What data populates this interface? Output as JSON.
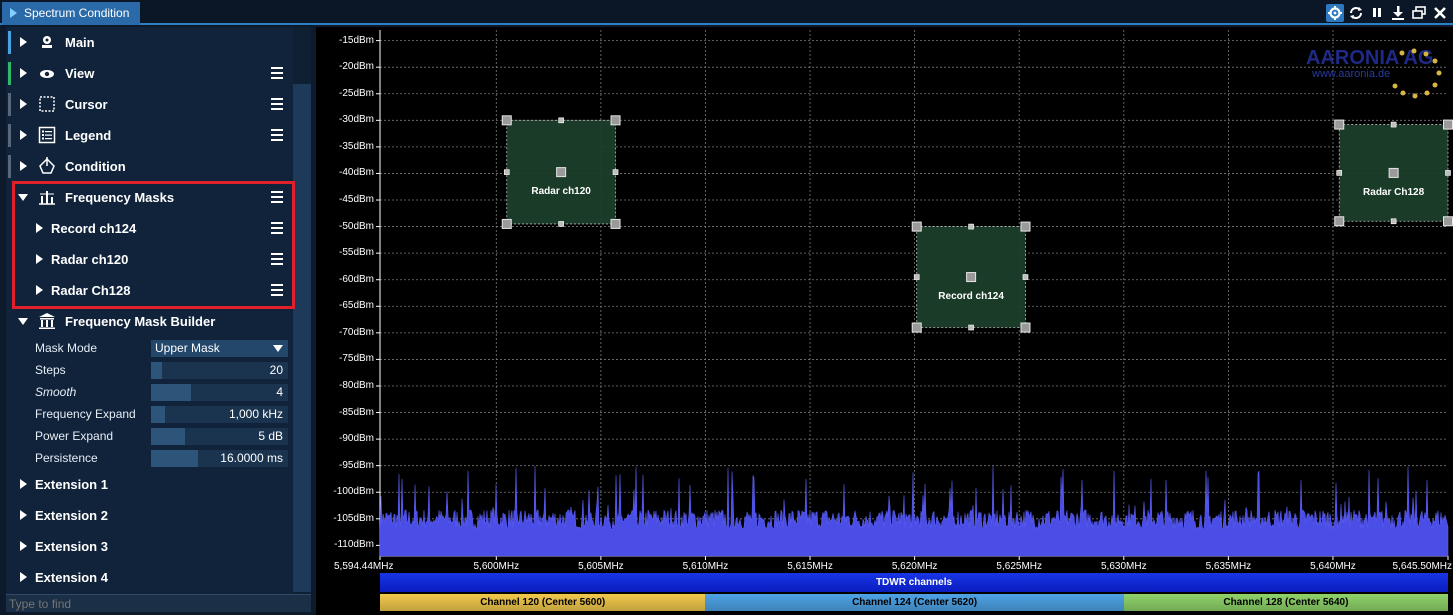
{
  "window": {
    "title": "Spectrum Condition",
    "buttons": [
      "gear-icon",
      "refresh-icon",
      "pause-icon",
      "download-icon",
      "restore-icon",
      "close-icon"
    ]
  },
  "sidebar": {
    "items": [
      {
        "label": "Main",
        "icon": "main-icon",
        "menu": false,
        "marker": "#4aa3e0"
      },
      {
        "label": "View",
        "icon": "eye-icon",
        "menu": true,
        "marker": "#2fb86b"
      },
      {
        "label": "Cursor",
        "icon": "cursor-icon",
        "menu": true,
        "marker": "#586779"
      },
      {
        "label": "Legend",
        "icon": "legend-icon",
        "menu": true,
        "marker": "#586779"
      },
      {
        "label": "Condition",
        "icon": "condition-icon",
        "menu": false,
        "marker": "#586779"
      },
      {
        "label": "Frequency Masks",
        "icon": "frequency-mask-icon",
        "menu": true,
        "expanded": true
      }
    ],
    "masks": [
      {
        "label": "Record ch124"
      },
      {
        "label": "Radar ch120"
      },
      {
        "label": "Radar Ch128"
      }
    ],
    "builder": {
      "label": "Frequency Mask Builder",
      "mask_mode_label": "Mask Mode",
      "mask_mode_value": "Upper Mask",
      "steps_label": "Steps",
      "steps_value": "20",
      "steps_fill": 0.08,
      "smooth_label": "Smooth",
      "smooth_value": "4",
      "smooth_fill": 0.29,
      "freq_expand_label": "Frequency Expand",
      "freq_expand_value": "1,000 kHz",
      "freq_expand_fill": 0.1,
      "power_expand_label": "Power Expand",
      "power_expand_value": "5 dB",
      "power_expand_fill": 0.25,
      "persistence_label": "Persistence",
      "persistence_value": "16.0000 ms",
      "persistence_fill": 0.34
    },
    "extensions": [
      "Extension 1",
      "Extension 2",
      "Extension 3",
      "Extension 4"
    ],
    "search_placeholder": "Type to find"
  },
  "plot": {
    "logo_text": "AARONIA AG",
    "logo_url": "www.aaronia.de",
    "tdwr_label": "TDWR channels",
    "channels": [
      {
        "label": "Channel 120 (Center 5600)",
        "start": 5594.44,
        "end": 5610,
        "color": "#f2c94c"
      },
      {
        "label": "Channel 124 (Center 5620)",
        "start": 5610,
        "end": 5630,
        "color": "#4ea3e6"
      },
      {
        "label": "Channel 128 (Center 5640)",
        "start": 5630,
        "end": 5645.5,
        "color": "#8fd36a"
      }
    ],
    "masks": [
      {
        "label": "Radar ch120",
        "f1": 5600.5,
        "f2": 5605.7,
        "p_top": -30,
        "p_bottom": -49.5
      },
      {
        "label": "Record ch124",
        "f1": 5620.1,
        "f2": 5625.3,
        "p_top": -50,
        "p_bottom": -69
      },
      {
        "label": "Radar Ch128",
        "f1": 5640.3,
        "f2": 5645.5,
        "p_top": -30.8,
        "p_bottom": -49
      }
    ]
  },
  "chart_data": {
    "type": "area",
    "title": "",
    "xlabel": "",
    "ylabel": "",
    "x_unit": "MHz",
    "y_unit": "dBm",
    "xlim": [
      5594.44,
      5645.5
    ],
    "ylim": [
      -112,
      -13
    ],
    "x_ticks": [
      "5,594.44MHz",
      "5,600MHz",
      "5,605MHz",
      "5,610MHz",
      "5,615MHz",
      "5,620MHz",
      "5,625MHz",
      "5,630MHz",
      "5,635MHz",
      "5,640MHz",
      "5,645.50MHz"
    ],
    "x_tick_values": [
      5594.44,
      5600,
      5605,
      5610,
      5615,
      5620,
      5625,
      5630,
      5635,
      5640,
      5645.5
    ],
    "y_ticks": [
      "-15dBm",
      "-20dBm",
      "-25dBm",
      "-30dBm",
      "-35dBm",
      "-40dBm",
      "-45dBm",
      "-50dBm",
      "-55dBm",
      "-60dBm",
      "-65dBm",
      "-70dBm",
      "-75dBm",
      "-80dBm",
      "-85dBm",
      "-90dBm",
      "-95dBm",
      "-100dBm",
      "-105dBm",
      "-110dBm"
    ],
    "y_tick_values": [
      -15,
      -20,
      -25,
      -30,
      -35,
      -40,
      -45,
      -50,
      -55,
      -60,
      -65,
      -70,
      -75,
      -80,
      -85,
      -90,
      -95,
      -100,
      -105,
      -110
    ],
    "grid": true,
    "series": [
      {
        "noise_floor_dbm": -105,
        "peak_dbm": -99,
        "color": "#4a4de6"
      }
    ]
  }
}
